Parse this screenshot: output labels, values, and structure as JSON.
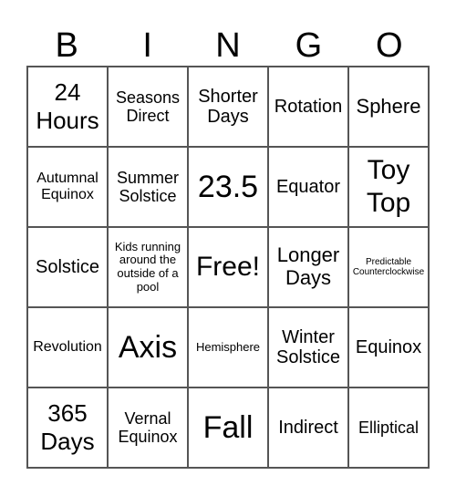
{
  "header": [
    "B",
    "I",
    "N",
    "G",
    "O"
  ],
  "cells": [
    {
      "text": "24 Hours",
      "size": "s26"
    },
    {
      "text": "Seasons Direct",
      "size": "s18"
    },
    {
      "text": "Shorter Days",
      "size": "s20"
    },
    {
      "text": "Rotation",
      "size": "s20"
    },
    {
      "text": "Sphere",
      "size": "s22"
    },
    {
      "text": "Autumnal Equinox",
      "size": "s16"
    },
    {
      "text": "Summer Solstice",
      "size": "s18"
    },
    {
      "text": "23.5",
      "size": "s34"
    },
    {
      "text": "Equator",
      "size": "s20"
    },
    {
      "text": "Toy Top",
      "size": "s30"
    },
    {
      "text": "Solstice",
      "size": "s20"
    },
    {
      "text": "Kids running around the outside of a pool",
      "size": "s13"
    },
    {
      "text": "Free!",
      "size": "s30"
    },
    {
      "text": "Longer Days",
      "size": "s22"
    },
    {
      "text": "Predictable Counterclockwise",
      "size": "s10"
    },
    {
      "text": "Revolution",
      "size": "s16"
    },
    {
      "text": "Axis",
      "size": "s34"
    },
    {
      "text": "Hemisphere",
      "size": "s13"
    },
    {
      "text": "Winter Solstice",
      "size": "s20"
    },
    {
      "text": "Equinox",
      "size": "s20"
    },
    {
      "text": "365 Days",
      "size": "s26"
    },
    {
      "text": "Vernal Equinox",
      "size": "s18"
    },
    {
      "text": "Fall",
      "size": "s34"
    },
    {
      "text": "Indirect",
      "size": "s20"
    },
    {
      "text": "Elliptical",
      "size": "s18"
    }
  ]
}
